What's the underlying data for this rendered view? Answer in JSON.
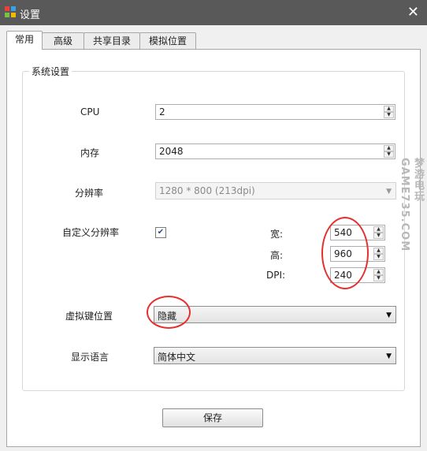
{
  "window": {
    "title": "设置",
    "close_icon": "close-icon"
  },
  "tabs": [
    {
      "label": "常用",
      "active": true
    },
    {
      "label": "高级"
    },
    {
      "label": "共享目录"
    },
    {
      "label": "模拟位置"
    }
  ],
  "group": {
    "title": "系统设置"
  },
  "cpu": {
    "label": "CPU",
    "value": "2"
  },
  "memory": {
    "label": "内存",
    "value": "2048"
  },
  "resolution": {
    "label": "分辨率",
    "value": "1280 * 800 (213dpi)",
    "disabled": true
  },
  "custom_resolution": {
    "label": "自定义分辨率",
    "checked": true,
    "width_label": "宽:",
    "width_value": "540",
    "height_label": "高:",
    "height_value": "960",
    "dpi_label": "DPI:",
    "dpi_value": "240"
  },
  "virtual_keys": {
    "label": "虚拟键位置",
    "value": "隐藏"
  },
  "language": {
    "label": "显示语言",
    "value": "简体中文"
  },
  "save_label": "保存",
  "watermark": "梦游电玩 GAME735.COM",
  "colors": {
    "titlebar": "#595959",
    "annotation": "#e53030"
  }
}
